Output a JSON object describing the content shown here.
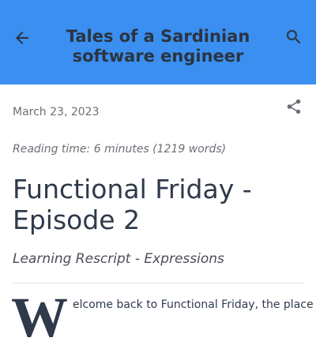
{
  "header": {
    "title_line1": "Tales of a Sardinian",
    "title_line2": "software engineer",
    "back_icon": "arrow-back-icon",
    "search_icon": "search-icon",
    "background_color": "#3a8ff0"
  },
  "post": {
    "date": "March 23, 2023",
    "share_icon": "share-icon",
    "reading_time": "Reading time: 6 minutes (1219 words)",
    "title_line1": "Functional Friday -",
    "title_line2": "Episode 2",
    "subtitle": "Learning Rescript - Expressions",
    "dropcap": "W",
    "intro_text": "elcome back to Functional Friday, the place"
  }
}
